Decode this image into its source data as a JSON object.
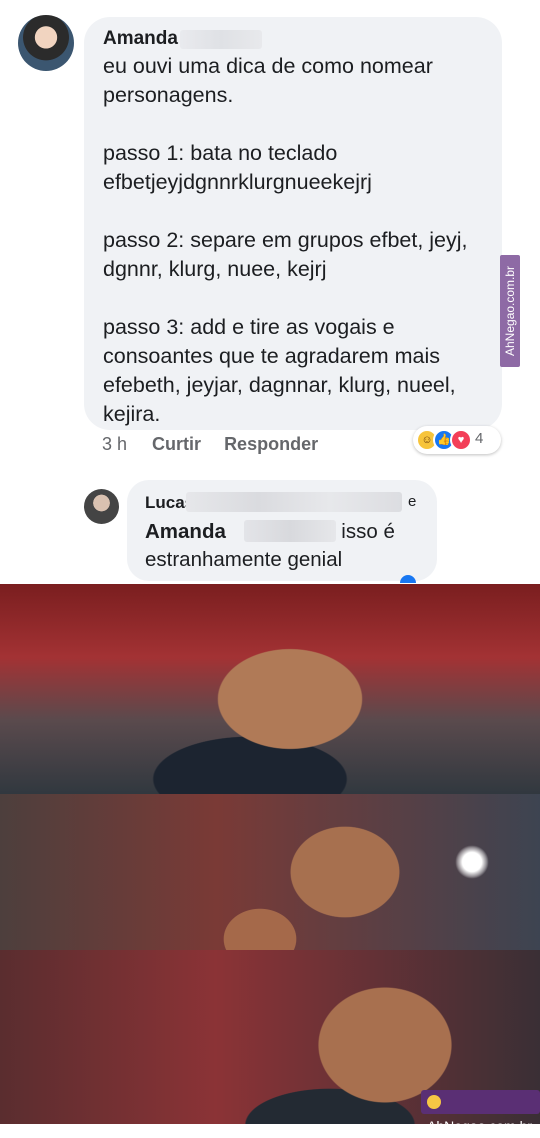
{
  "comment": {
    "author": "Amanda",
    "text": "eu ouvi uma dica de como nomear personagens.\n\npasso 1: bata no teclado efbetjeyjdgnnrklurgnueekejrj\n\npasso 2: separe em grupos efbet, jeyj, dgnnr, klurg, nuee, kejrj\n\npasso 3: add e tire as vogais e consoantes que te agradarem mais efebeth, jeyjar, dagnnar, klurg, nueel, kejira.",
    "time": "3 h",
    "like_label": "Curtir",
    "reply_label": "Responder",
    "reaction_count": "4",
    "reactions": [
      "haha-icon",
      "like-icon",
      "love-icon"
    ]
  },
  "reply": {
    "author": "Lucas I",
    "author_tail": "e",
    "tagged": "Amanda",
    "text_after_tag": "isso é",
    "text_line2": "estranhamente genial"
  },
  "watermarks": {
    "side": "AhNegao.com.br",
    "bottom": "AhNegao.com.br"
  },
  "colors": {
    "bubble": "#f0f2f5",
    "meta": "#65676b",
    "like_blue": "#1877f2",
    "watermark": "#5a2f74"
  }
}
